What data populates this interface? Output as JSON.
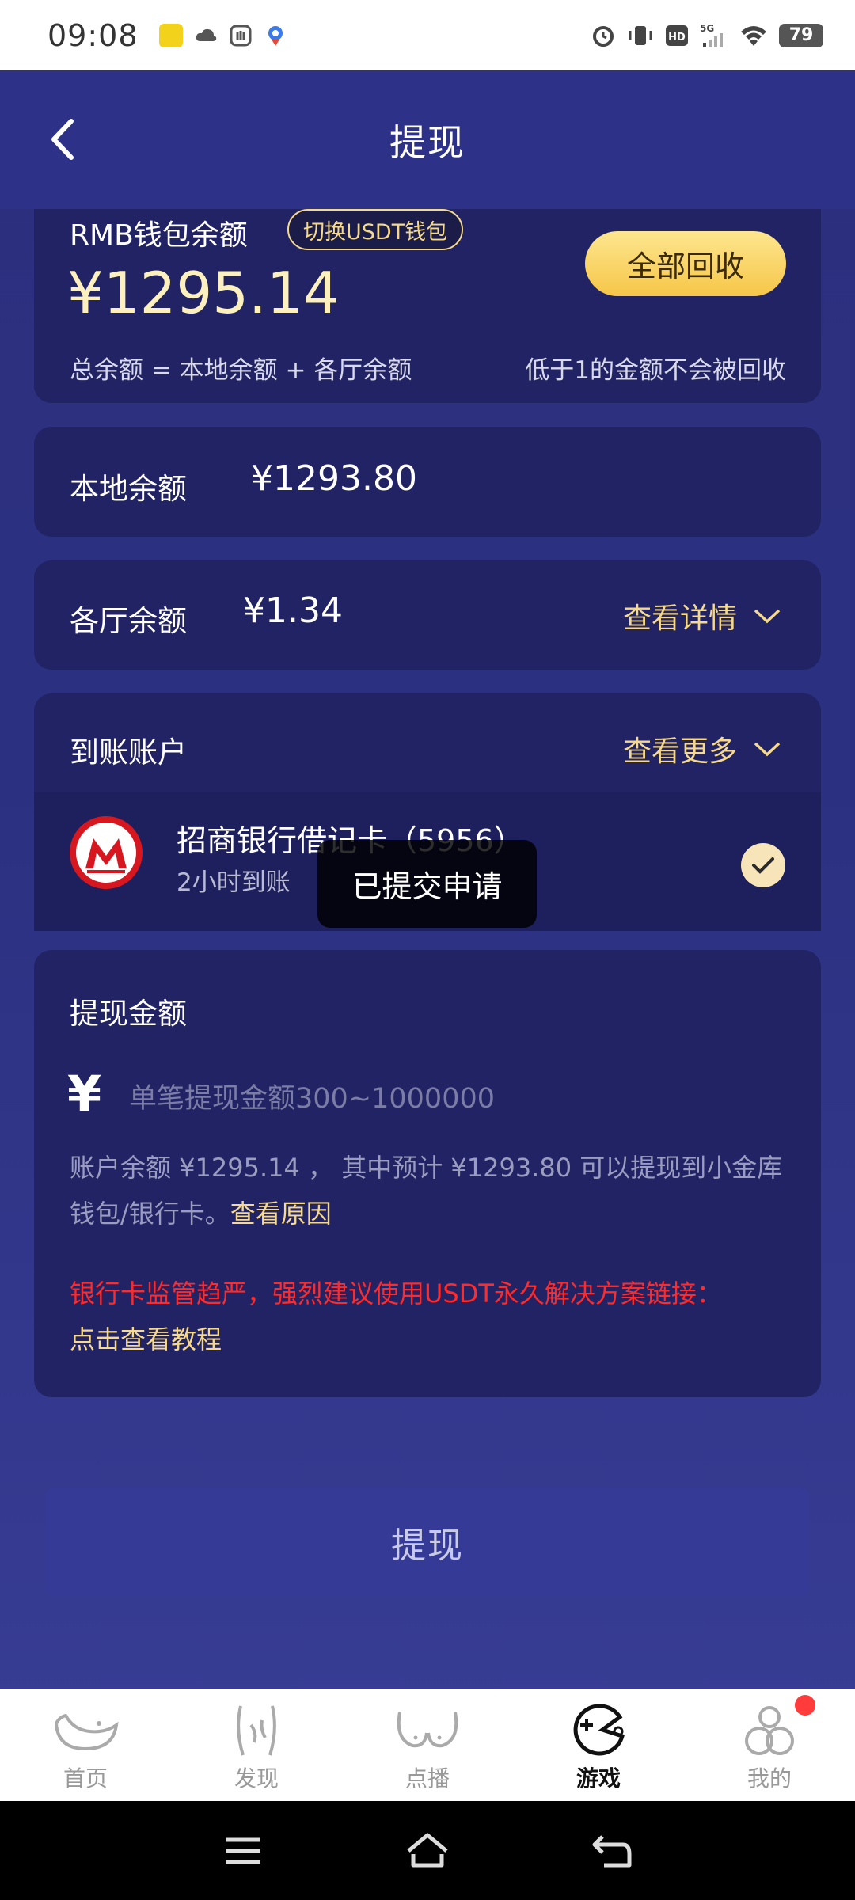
{
  "status_bar": {
    "time": "09:08",
    "battery": "79",
    "network": "5G"
  },
  "header": {
    "title": "提现"
  },
  "wallet": {
    "label": "RMB钱包余额",
    "switch_label": "切换USDT钱包",
    "total_balance": "¥1295.14",
    "reclaim_label": "全部回收",
    "formula": "总余额 = 本地余额 + 各厅余额",
    "reclaim_note": "低于1的金额不会被回收"
  },
  "local": {
    "label": "本地余额",
    "value": "¥1293.80"
  },
  "halls": {
    "label": "各厅余额",
    "value": "¥1.34",
    "link": "查看详情"
  },
  "account": {
    "label": "到账账户",
    "more_link": "查看更多",
    "bank_name": "招商银行借记卡（5956）",
    "bank_sub": "2小时到账",
    "toast": "已提交申请"
  },
  "amount": {
    "title": "提现金额",
    "currency": "¥",
    "placeholder": "单笔提现金额300~1000000",
    "note": "账户余额 ¥1295.14 ， 其中预计 ¥1293.80 可以提现到小金库钱包/银行卡。",
    "reason_link": "查看原因",
    "warning": "银行卡监管趋严，强烈建议使用USDT永久解决方案链接：",
    "tutorial_link": "点击查看教程"
  },
  "withdraw_button": "提现",
  "nav": [
    {
      "label": "首页",
      "icon": "home-icon"
    },
    {
      "label": "发现",
      "icon": "discover-icon"
    },
    {
      "label": "点播",
      "icon": "vod-icon"
    },
    {
      "label": "游戏",
      "icon": "game-icon"
    },
    {
      "label": "我的",
      "icon": "profile-icon"
    }
  ],
  "colors": {
    "accent": "#f6d98a",
    "card": "#212364",
    "warning": "#ff2a2a"
  }
}
